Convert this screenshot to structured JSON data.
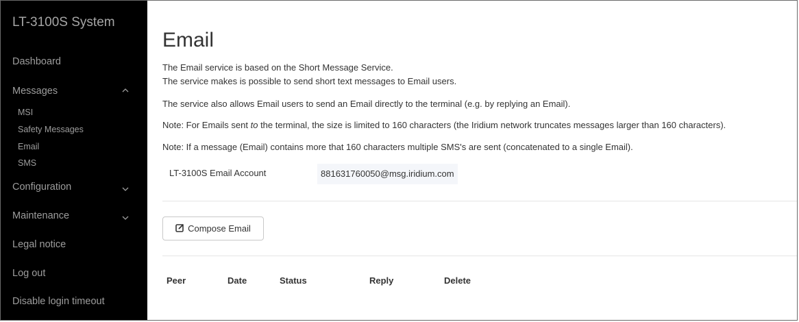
{
  "sidebar": {
    "brand": "LT-3100S System",
    "items": [
      {
        "label": "Dashboard"
      },
      {
        "label": "Messages",
        "chevron": "chevron-up-icon"
      },
      {
        "label": "Configuration",
        "chevron": "chevron-down-icon"
      },
      {
        "label": "Maintenance",
        "chevron": "chevron-down-icon"
      },
      {
        "label": "Legal notice"
      },
      {
        "label": "Log out"
      },
      {
        "label": "Disable login timeout"
      }
    ],
    "messages_sub": [
      {
        "label": "MSI"
      },
      {
        "label": "Safety Messages"
      },
      {
        "label": "Email"
      },
      {
        "label": "SMS"
      }
    ]
  },
  "main": {
    "title": "Email",
    "paragraphs": [
      "The Email service is based on the Short Message Service.",
      "The service makes is possible to send short text messages to Email users.",
      "The service also allows Email users to send an Email directly to the terminal (e.g. by replying an Email).",
      "Note: For Emails sent ",
      "to",
      " the terminal, the size is limited to 160 characters (the Iridium network truncates messages larger than 160 characters).",
      "Note: If a message (Email) contains more that 160 characters multiple SMS's are sent (concatenated to a single Email)."
    ],
    "account_label": "LT-3100S Email Account",
    "account_value": "881631760050@msg.iridium.com",
    "compose_label": "Compose Email",
    "compose_icon": "edit-icon",
    "table_headers": [
      "Peer",
      "Date",
      "Status",
      "Reply",
      "Delete"
    ]
  }
}
